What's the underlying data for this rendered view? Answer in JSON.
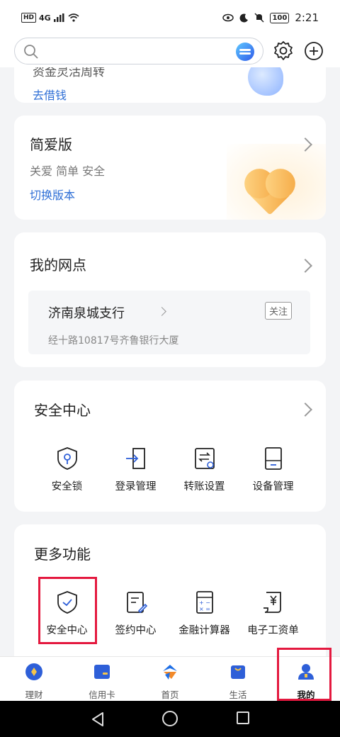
{
  "status_bar": {
    "left_badge": "HD",
    "network": "4G",
    "battery": "100",
    "time": "2:21"
  },
  "loan_card": {
    "cut_text": "资金灵活周转",
    "link": "去借钱"
  },
  "simple_card": {
    "title": "简爱版",
    "subtitle": "关爱 简单 安全",
    "link": "切换版本"
  },
  "branch_card": {
    "title": "我的网点",
    "branch_name": "济南泉城支行",
    "follow_label": "关注",
    "address": "经十路10817号齐鲁银行大厦"
  },
  "security_center": {
    "title": "安全中心",
    "items": [
      {
        "label": "安全锁",
        "icon": "shield-lock-icon"
      },
      {
        "label": "登录管理",
        "icon": "login-door-icon"
      },
      {
        "label": "转账设置",
        "icon": "transfer-settings-icon"
      },
      {
        "label": "设备管理",
        "icon": "device-icon"
      }
    ]
  },
  "more_functions": {
    "title": "更多功能",
    "items": [
      {
        "label": "安全中心",
        "icon": "shield-check-icon"
      },
      {
        "label": "签约中心",
        "icon": "sign-document-icon"
      },
      {
        "label": "金融计算器",
        "icon": "calculator-icon"
      },
      {
        "label": "电子工资单",
        "icon": "yen-receipt-icon"
      }
    ]
  },
  "tabbar": {
    "items": [
      {
        "label": "理财",
        "icon": "wealth-icon"
      },
      {
        "label": "信用卡",
        "icon": "credit-card-icon"
      },
      {
        "label": "首页",
        "icon": "home-logo-icon"
      },
      {
        "label": "生活",
        "icon": "shopping-bag-icon"
      },
      {
        "label": "我的",
        "icon": "profile-icon",
        "active": true
      }
    ]
  },
  "colors": {
    "link_blue": "#2f6fd6",
    "icon_blue": "#2e5fd8",
    "highlight_red": "#e4193f"
  }
}
